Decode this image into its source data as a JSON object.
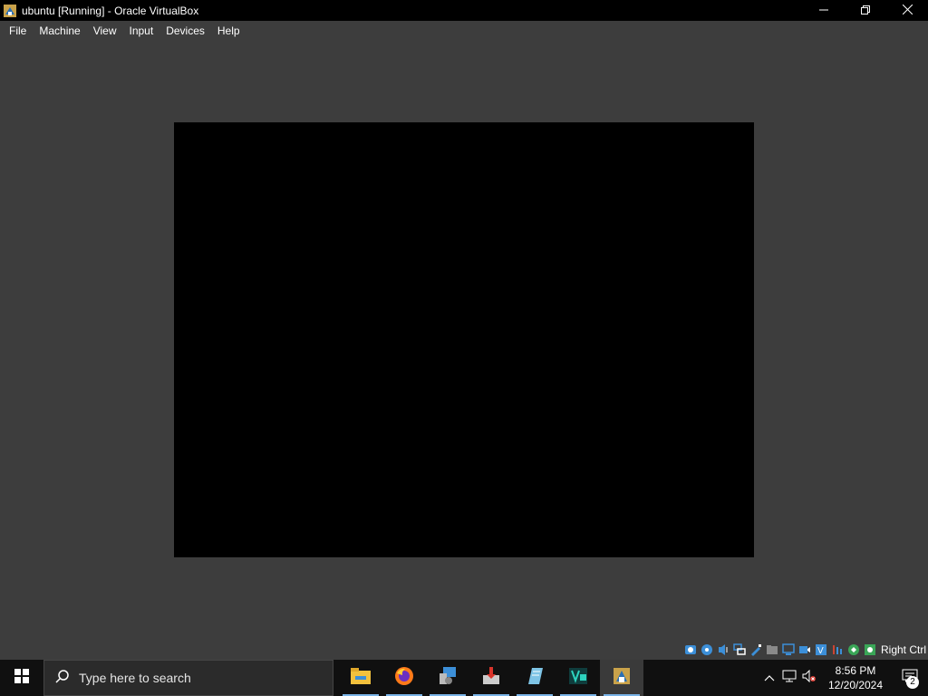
{
  "window": {
    "title": "ubuntu [Running] - Oracle VirtualBox",
    "icon": "virtualbox-icon",
    "controls": [
      "minimize-icon",
      "restore-icon",
      "close-icon"
    ]
  },
  "menu": [
    {
      "label": "File"
    },
    {
      "label": "Machine"
    },
    {
      "label": "View"
    },
    {
      "label": "Input"
    },
    {
      "label": "Devices"
    },
    {
      "label": "Help"
    }
  ],
  "statusbar": {
    "icons": [
      "hard-disk-icon",
      "optical-drive-icon",
      "audio-icon",
      "network-icon",
      "usb-icon",
      "shared-folders-icon",
      "display-icon",
      "recording-icon",
      "vt-x-icon",
      "cpu-icon",
      "mouse-integration-icon"
    ],
    "host_key": "Right Ctrl"
  },
  "taskbar": {
    "search_placeholder": "Type here to search",
    "apps": [
      "file-explorer-icon",
      "firefox-icon",
      "device-manager-icon",
      "installer-icon",
      "notepad-icon",
      "visual-studio-icon",
      "virtualbox-icon"
    ],
    "tray_icons": [
      "show-hidden-icons-chevron",
      "network-icon",
      "volume-muted-icon"
    ],
    "time": "8:56 PM",
    "date": "12/20/2024",
    "notification_count": "2"
  },
  "colors": {
    "titlebar": "#000000",
    "workspace": "#3d3d3d",
    "vm_screen": "#000000",
    "taskbar": "#101010"
  }
}
